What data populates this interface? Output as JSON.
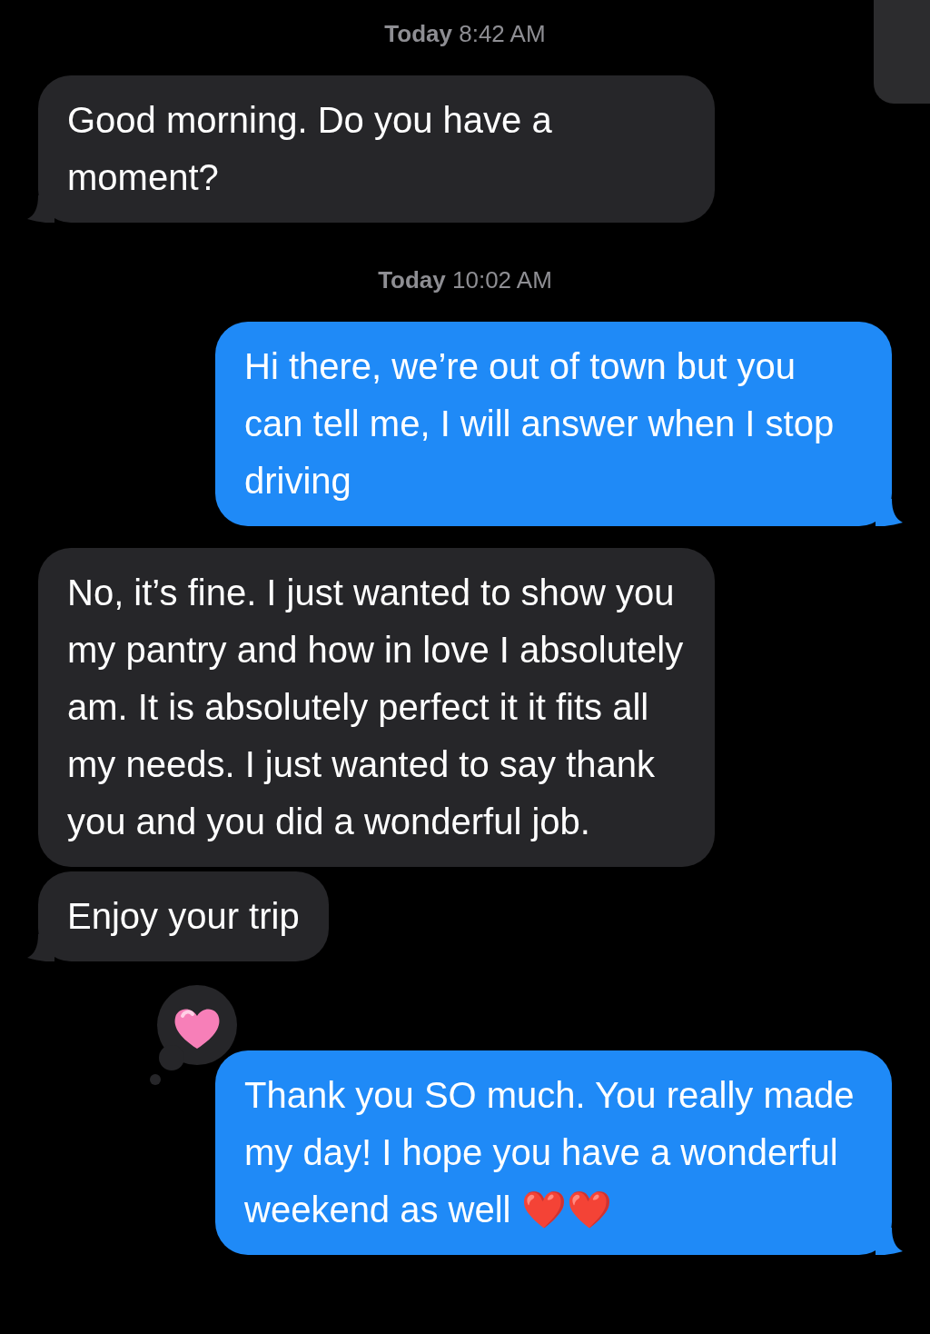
{
  "messages": [
    {
      "kind": "timestamp",
      "day": "Today",
      "time": "8:42 AM"
    },
    {
      "kind": "incoming",
      "text": "Good morning. Do you have a moment?",
      "tail": true
    },
    {
      "kind": "timestamp",
      "day": "Today",
      "time": "10:02 AM"
    },
    {
      "kind": "outgoing",
      "text": "Hi there, we’re out of town but you can tell me, I will answer when I stop driving",
      "tail": true
    },
    {
      "kind": "incoming",
      "text": "No, it’s fine. I just wanted to show you my pantry and how in love I absolutely am. It is absolutely perfect it it fits all my needs. I just wanted to say thank you and you did a wonderful job.",
      "tail": false
    },
    {
      "kind": "incoming",
      "text": "Enjoy your trip",
      "tail": true
    },
    {
      "kind": "outgoing",
      "text": "Thank you SO much. You really made my day! I hope you have a wonderful weekend as well ❤️❤️",
      "tail": true,
      "tapback": true
    }
  ]
}
